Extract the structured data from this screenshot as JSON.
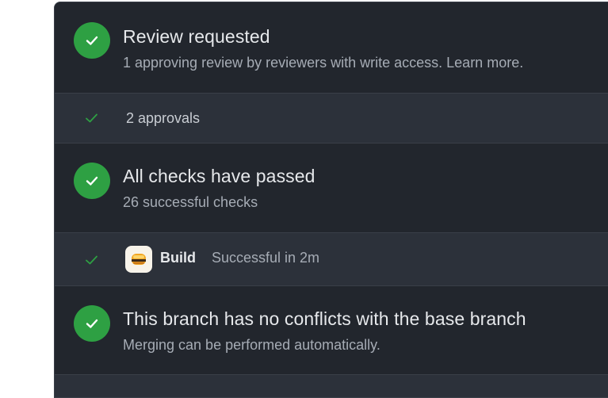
{
  "colors": {
    "success": "#2ea043",
    "panel_bg": "#23272e",
    "sub_row_bg": "#2c313a"
  },
  "review": {
    "icon": "check-circle-icon",
    "title": "Review requested",
    "description": "1 approving review by reviewers with write access. Learn more."
  },
  "approvals": {
    "icon": "check-icon",
    "label": "2 approvals"
  },
  "checks": {
    "icon": "check-circle-icon",
    "title": "All checks have passed",
    "description": "26 successful checks"
  },
  "build": {
    "icon": "check-icon",
    "app_icon": "build-app-icon",
    "name": "Build",
    "status": "Successful in 2m"
  },
  "conflicts": {
    "icon": "check-circle-icon",
    "title": "This branch has no conflicts with the base branch",
    "description": "Merging can be performed automatically."
  }
}
